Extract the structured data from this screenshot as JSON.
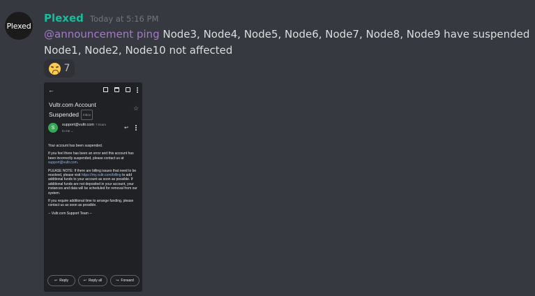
{
  "message": {
    "avatar_text": "Plexed",
    "username": "Plexed",
    "timestamp": "Today at 5:16 PM",
    "mention": "@announcement ping",
    "line1_text": " Node3, Node4, Node5, Node6, Node7, Node8, Node9 have suspended",
    "line2_text": "Node1, Node2, Node10 not affected",
    "reaction": {
      "emoji": "tired-face-emoji",
      "count": "7"
    }
  },
  "attachment": {
    "subject": "Vultr.com Account Suspended",
    "inbox_label": "Inbox",
    "sender_initial": "S",
    "sender": "support@vultr.com",
    "sent_time": "7:01am",
    "to": "to me",
    "body": {
      "p1": "Your account                    has been suspended.",
      "p2_a": "If you feel there has been an error and this account has been incorrectly suspended, please contact us at ",
      "p2_link": "support@vultr.com",
      "p2_b": ".",
      "p3_a": "PLEASE NOTE: If there are billing issues that need to be resolved, please visit ",
      "p3_link": "https://my.vultr.com/billing",
      "p3_b": " to add additional funds to your account as soon as possible. If additional funds are not deposited in your account, your instances and data will be scheduled for removal from our system.",
      "p4": "If you require additional time to arrange funding, please contact us as soon as possible.",
      "p5": "-- Vultr.com Support Team --"
    },
    "actions": {
      "reply": "Reply",
      "reply_all": "Reply all",
      "forward": "Forward"
    }
  },
  "colors": {
    "background": "#36393f",
    "username": "#1abc9c",
    "mention": "#a47ac6",
    "phone_bg": "#202124"
  }
}
